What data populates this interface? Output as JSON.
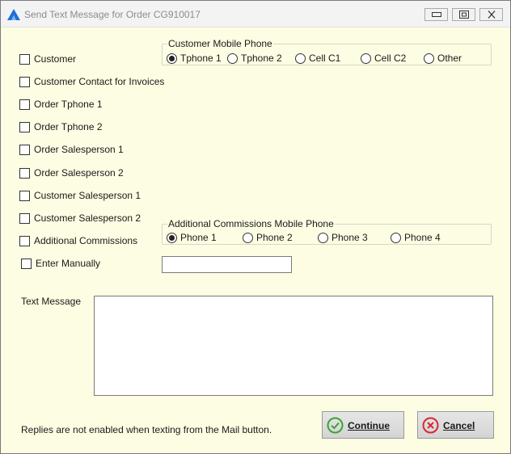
{
  "window": {
    "title": "Send Text Message for Order CG910017"
  },
  "recipients": [
    "Customer",
    "Customer Contact for Invoices",
    "Order Tphone 1",
    "Order Tphone 2",
    "Order Salesperson 1",
    "Order Salesperson 2",
    "Customer Salesperson 1",
    "Customer Salesperson 2",
    "Additional Commissions",
    "Enter Manually"
  ],
  "customer_phone": {
    "legend": "Customer Mobile Phone",
    "options": [
      "Tphone 1",
      "Tphone 2",
      "Cell C1",
      "Cell C2",
      "Other"
    ],
    "selected": "Tphone 1"
  },
  "commissions_phone": {
    "legend": "Additional Commissions Mobile Phone",
    "options": [
      "Phone 1",
      "Phone 2",
      "Phone 3",
      "Phone 4"
    ],
    "selected": "Phone 1"
  },
  "manual_entry": {
    "value": ""
  },
  "message": {
    "label": "Text Message",
    "value": ""
  },
  "footer": {
    "note": "Replies are not enabled when texting from the Mail button.",
    "continue_label": "Continue",
    "cancel_label": "Cancel"
  },
  "colors": {
    "background": "#fdfde3",
    "continue_icon": "#3aa335",
    "cancel_icon": "#d8282f"
  }
}
